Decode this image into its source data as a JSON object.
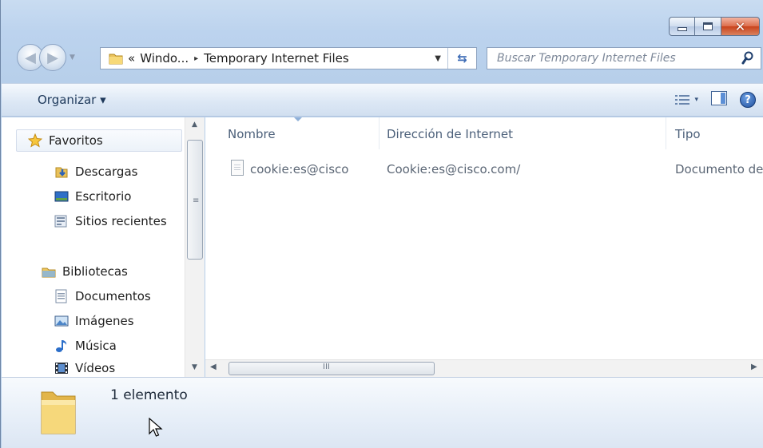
{
  "window": {
    "caption_buttons": {
      "min_icon": "minimize-icon",
      "max_icon": "maximize-icon",
      "close_icon": "close-icon"
    }
  },
  "address_bar": {
    "overflow_glyph": "«",
    "parts": [
      "Windo...",
      "Temporary Internet Files"
    ],
    "separator_glyph": "▸"
  },
  "search": {
    "placeholder": "Buscar Temporary Internet Files"
  },
  "command_bar": {
    "organize_label": "Organizar ▾",
    "views_arrow": "▾",
    "help_glyph": "?"
  },
  "nav_pane": {
    "favorites": {
      "label": "Favoritos",
      "icon": "star-icon"
    },
    "favorite_items": [
      {
        "label": "Descargas",
        "icon": "downloads-icon"
      },
      {
        "label": "Escritorio",
        "icon": "desktop-icon"
      },
      {
        "label": "Sitios recientes",
        "icon": "recent-places-icon"
      }
    ],
    "libraries": {
      "label": "Bibliotecas",
      "icon": "libraries-icon"
    },
    "library_items": [
      {
        "label": "Documentos",
        "icon": "documents-icon"
      },
      {
        "label": "Imágenes",
        "icon": "pictures-icon"
      },
      {
        "label": "Música",
        "icon": "music-icon"
      },
      {
        "label": "Vídeos",
        "icon": "videos-icon"
      }
    ]
  },
  "file_list": {
    "columns": [
      "Nombre",
      "Dirección de Internet",
      "Tipo"
    ],
    "rows": [
      {
        "name": "cookie:es@cisco",
        "internet_address": "Cookie:es@cisco.com/",
        "type": "Documento de"
      }
    ]
  },
  "details_pane": {
    "item_count": "1 elemento"
  },
  "colors": {
    "frame": "#bcd3ee",
    "accent": "#1e395b",
    "close": "#c9421b"
  }
}
